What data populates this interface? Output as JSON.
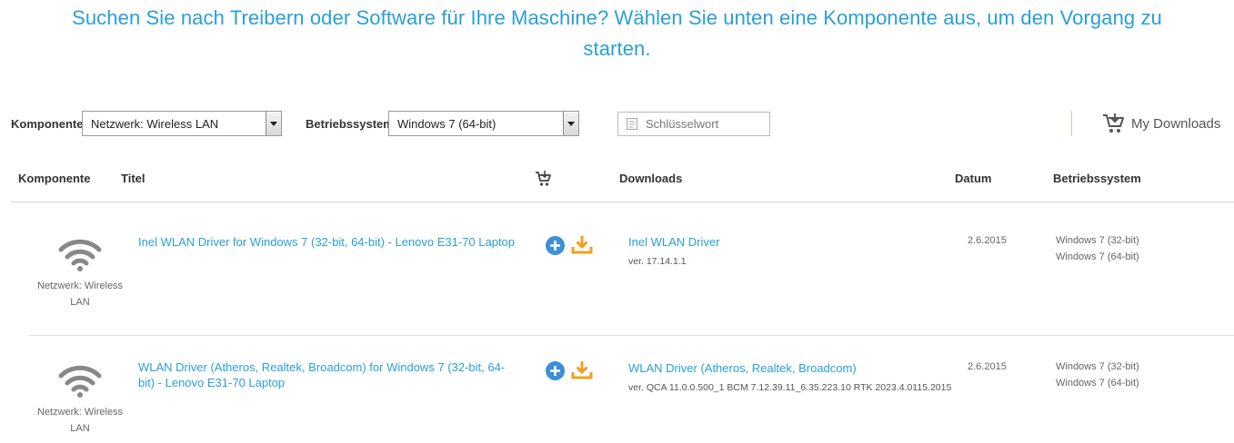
{
  "headline": {
    "line1": "Suchen Sie nach Treibern oder Software für Ihre Maschine? Wählen Sie unten eine Komponente aus, um den Vorgang zu",
    "line2": "starten."
  },
  "filters": {
    "component_label": "Komponente",
    "component_value": "Netzwerk: Wireless LAN",
    "os_label": "Betriebssystem",
    "os_value": "Windows 7 (64-bit)",
    "keyword_placeholder": "Schlüsselwort",
    "my_downloads": "My Downloads"
  },
  "table": {
    "headers": {
      "component": "Komponente",
      "title": "Titel",
      "downloads": "Downloads",
      "date": "Datum",
      "os": "Betriebssystem"
    },
    "rows": [
      {
        "component": "Netzwerk: Wireless LAN",
        "title": "Inel WLAN Driver for Windows 7 (32-bit, 64-bit) - Lenovo E31-70 Laptop",
        "download_name": "Inel WLAN Driver",
        "download_version": "ver. 17.14.1.1",
        "date": "2.6.2015",
        "os1": "Windows 7 (32-bit)",
        "os2": "Windows 7 (64-bit)"
      },
      {
        "component": "Netzwerk: Wireless LAN",
        "title": "WLAN Driver (Atheros, Realtek, Broadcom) for Windows 7 (32-bit, 64-bit) - Lenovo E31-70 Laptop",
        "download_name": "WLAN Driver (Atheros, Realtek, Broadcom)",
        "download_version": "ver. QCA 11.0.0.500_1 BCM 7.12.39.11_6.35.223.10 RTK 2023.4.0115.2015",
        "date": "2.6.2015",
        "os1": "Windows 7 (32-bit)",
        "os2": "Windows 7 (64-bit)"
      }
    ]
  },
  "colors": {
    "accent": "#2a9fd6",
    "plus_button": "#3d8fd6",
    "download_icon": "#f0a020"
  },
  "icons": [
    "wifi-icon",
    "add-icon",
    "download-icon",
    "cart-icon",
    "keyword-icon"
  ]
}
